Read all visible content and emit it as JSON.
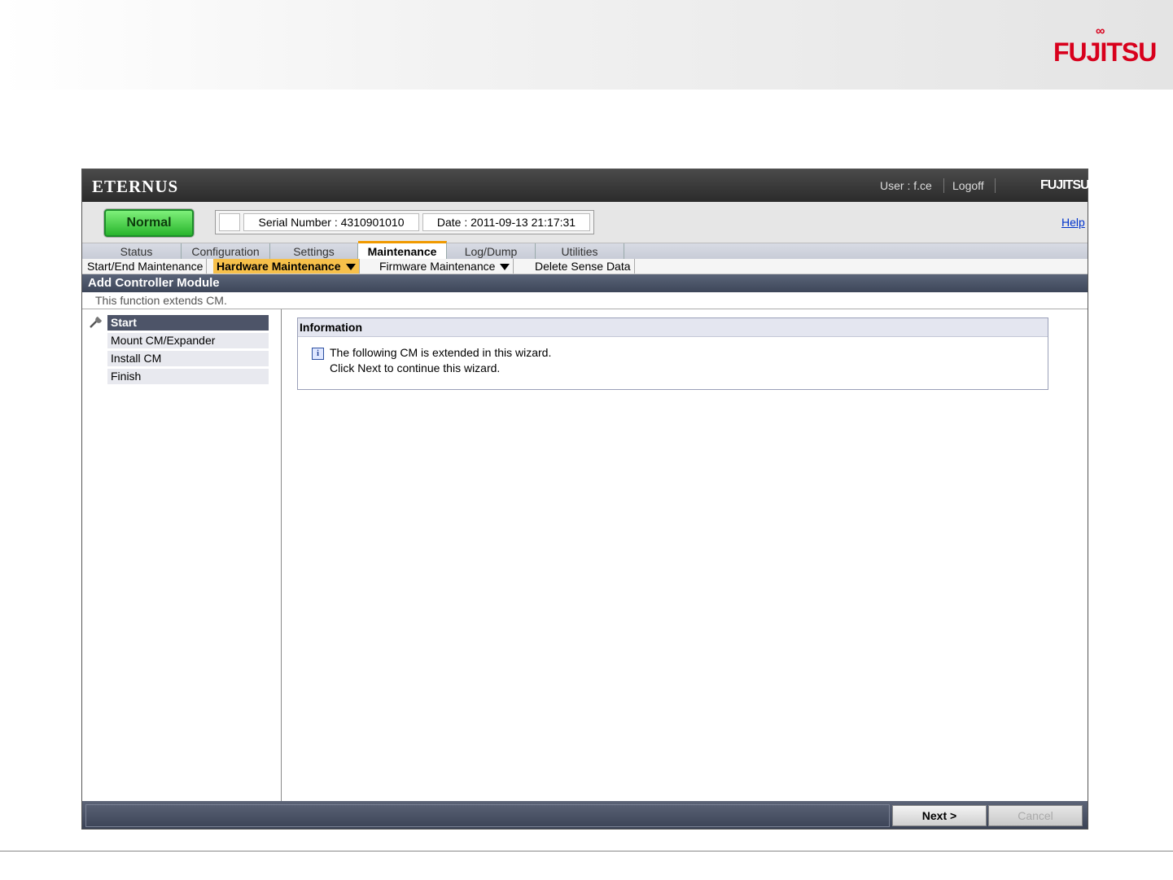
{
  "slide": {
    "logo": "FUJITSU"
  },
  "header": {
    "brand": "ETERNUS",
    "user": "User : f.ce",
    "logoff": "Logoff",
    "logo": "FUJITSU"
  },
  "status": {
    "state": "Normal",
    "serial": "Serial Number : 4310901010",
    "date": "Date : 2011-09-13 21:17:31",
    "help": "Help"
  },
  "tabs": [
    "Status",
    "Configuration",
    "Settings",
    "Maintenance",
    "Log/Dump",
    "Utilities"
  ],
  "subnav": {
    "items": [
      "Start/End Maintenance",
      "Hardware Maintenance",
      "Firmware Maintenance",
      "Delete Sense Data"
    ]
  },
  "page": {
    "title": "Add Controller Module",
    "description": "This function extends CM."
  },
  "steps": [
    "Start",
    "Mount CM/Expander",
    "Install CM",
    "Finish"
  ],
  "info": {
    "title": "Information",
    "icon": "i",
    "line1": "The following CM is extended in this wizard.",
    "line2": "Click Next to continue this wizard."
  },
  "buttons": {
    "next": "Next >",
    "cancel": "Cancel"
  }
}
